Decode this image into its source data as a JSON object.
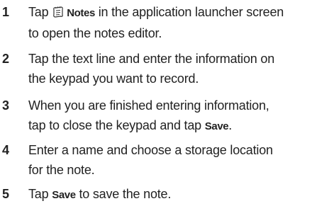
{
  "steps": [
    {
      "number": "1",
      "pre": "Tap ",
      "term": "Notes",
      "icon": "notes-icon",
      "post_line1": " in the application launcher screen",
      "line2": "to open the notes editor."
    },
    {
      "number": "2",
      "line1": "Tap the text line and enter the information on",
      "line2": "the keypad you want to record."
    },
    {
      "number": "3",
      "line1": "When you are finished entering information,",
      "line2_pre": "tap to close the keypad and tap ",
      "term": "Save",
      "line2_post": "."
    },
    {
      "number": "4",
      "line1": "Enter a name and choose a storage location",
      "line2": "for the note."
    },
    {
      "number": "5",
      "pre": "Tap ",
      "term": "Save",
      "post": " to save the note."
    }
  ]
}
